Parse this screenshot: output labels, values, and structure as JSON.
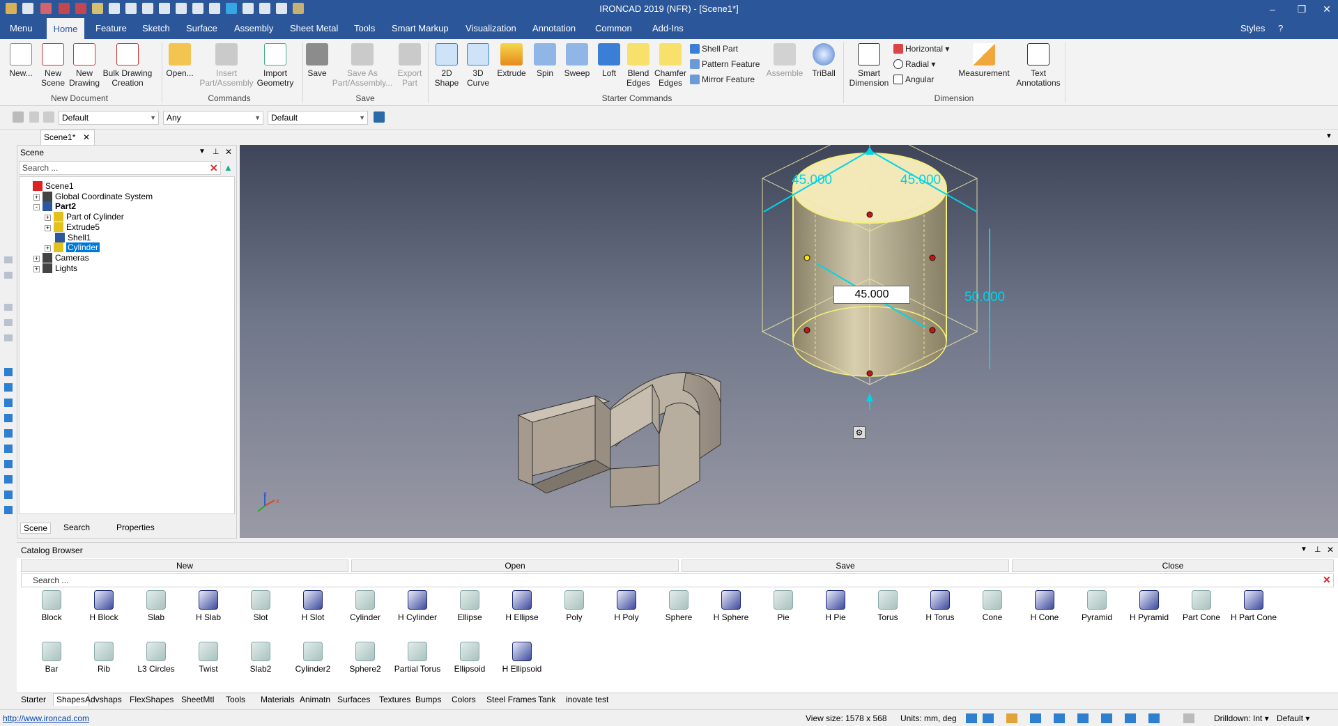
{
  "window": {
    "title": "IRONCAD 2019 (NFR) - [Scene1*]"
  },
  "menu_tabs": [
    "Menu",
    "Home",
    "Feature",
    "Sketch",
    "Surface",
    "Assembly",
    "Sheet Metal",
    "Tools",
    "Smart Markup",
    "Visualization",
    "Annotation",
    "Common",
    "Add-Ins"
  ],
  "styles_label": "Styles",
  "ribbon": {
    "new_document": {
      "group": "New Document",
      "new": "New...",
      "new_scene": "New\nScene",
      "new_drawing": "New\nDrawing",
      "bulk": "Bulk Drawing\nCreation"
    },
    "commands": {
      "group": "Commands",
      "open": "Open...",
      "insert": "Insert\nPart/Assembly",
      "import": "Import\nGeometry"
    },
    "save": {
      "group": "Save",
      "save": "Save",
      "save_as": "Save As\nPart/Assembly...",
      "export": "Export\nPart"
    },
    "starter": {
      "group": "Starter Commands",
      "shape2d": "2D\nShape",
      "curve3d": "3D\nCurve",
      "extrude": "Extrude",
      "spin": "Spin",
      "sweep": "Sweep",
      "loft": "Loft",
      "blend": "Blend\nEdges",
      "chamfer": "Chamfer\nEdges",
      "shell": "Shell Part",
      "pattern": "Pattern Feature",
      "mirror": "Mirror Feature",
      "assemble": "Assemble",
      "triball": "TriBall"
    },
    "dimension": {
      "group": "Dimension",
      "smart": "Smart\nDimension",
      "horizontal": "Horizontal",
      "radial": "Radial",
      "angular": "Angular",
      "measurement": "Measurement",
      "text": "Text\nAnnotations"
    }
  },
  "toolbar2": {
    "combo1": "Default",
    "combo2": "Any",
    "combo3": "Default"
  },
  "doc_tab": "Scene1*",
  "scene_panel": {
    "title": "Scene",
    "search_placeholder": "Search ...",
    "tree": [
      {
        "label": "Scene1",
        "level": 0,
        "expand": "",
        "selected": false,
        "bold": false
      },
      {
        "label": "Global Coordinate System",
        "level": 1,
        "expand": "+",
        "selected": false,
        "bold": false
      },
      {
        "label": "Part2",
        "level": 1,
        "expand": "-",
        "selected": false,
        "bold": true
      },
      {
        "label": "Part of Cylinder",
        "level": 2,
        "expand": "+",
        "selected": false,
        "bold": false
      },
      {
        "label": "Extrude5",
        "level": 2,
        "expand": "+",
        "selected": false,
        "bold": false
      },
      {
        "label": "Shell1",
        "level": 2,
        "expand": "",
        "selected": false,
        "bold": false
      },
      {
        "label": "Cylinder",
        "level": 2,
        "expand": "+",
        "selected": true,
        "bold": false
      },
      {
        "label": "Cameras",
        "level": 1,
        "expand": "+",
        "selected": false,
        "bold": false
      },
      {
        "label": "Lights",
        "level": 1,
        "expand": "+",
        "selected": false,
        "bold": false
      }
    ],
    "tabs": [
      "Scene",
      "Search",
      "Properties"
    ]
  },
  "viewport": {
    "dims": {
      "width_left": "45.000",
      "width_right": "45.000",
      "height": "50.000",
      "input": "45.000"
    },
    "axis_labels": {
      "z": "z",
      "x": "x"
    }
  },
  "catalog": {
    "title": "Catalog Browser",
    "bar": [
      "New",
      "Open",
      "Save",
      "Close"
    ],
    "search_placeholder": "Search ...",
    "row1": [
      "Block",
      "H Block",
      "Slab",
      "H Slab",
      "Slot",
      "H Slot",
      "Cylinder",
      "H Cylinder",
      "Ellipse",
      "H Ellipse",
      "Poly",
      "H Poly",
      "Sphere",
      "H Sphere",
      "Pie",
      "H Pie",
      "Torus",
      "H Torus",
      "Cone",
      "H Cone",
      "Pyramid",
      "H Pyramid",
      "Part Cone",
      "H Part Cone"
    ],
    "row2": [
      "Bar",
      "Rib",
      "L3 Circles",
      "Twist",
      "Slab2",
      "Cylinder2",
      "Sphere2",
      "Partial Torus",
      "Ellipsoid",
      "H Ellipsoid"
    ],
    "tabs": [
      "Starter",
      "Shapes",
      "Advshaps",
      "FlexShapes",
      "SheetMtl",
      "Tools",
      "Materials",
      "Animatn",
      "Surfaces",
      "Textures",
      "Bumps",
      "Colors",
      "Steel Frames",
      "Tank",
      "inovate test"
    ]
  },
  "status": {
    "link": "http://www.ironcad.com",
    "view_size": "View size: 1578 x  568",
    "units": "Units: mm, deg",
    "drilldown": "Drilldown: Int",
    "default": "Default"
  },
  "colors": {
    "accent": "#2b579a",
    "dimension": "#00d4e8",
    "select": "#0078d7"
  }
}
